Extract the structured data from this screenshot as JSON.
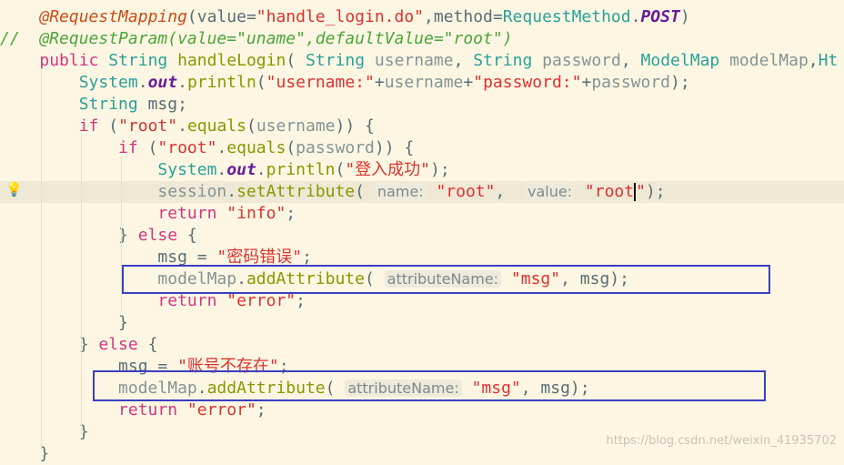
{
  "editor": {
    "highlighted_line": 8,
    "colors": {
      "background": "#fdf6e3",
      "keyword": "#d33682",
      "type": "#2aa198",
      "method": "#859900",
      "string": "#dc322f",
      "annotation_box": "#3a3fc4"
    },
    "lines": [
      [
        [
          "plain",
          "    "
        ],
        [
          "ann",
          "@RequestMapping"
        ],
        [
          "plain",
          "(value="
        ],
        [
          "str",
          "\"handle_login.do\""
        ],
        [
          "plain",
          ",method="
        ],
        [
          "type",
          "RequestMethod"
        ],
        [
          "plain",
          "."
        ],
        [
          "const",
          "POST"
        ],
        [
          "plain",
          ")"
        ]
      ],
      [
        [
          "comment",
          "//  @RequestParam(value=\"uname\",defaultValue=\"root\")"
        ]
      ],
      [
        [
          "plain",
          "    "
        ],
        [
          "kw",
          "public"
        ],
        [
          "plain",
          " "
        ],
        [
          "type",
          "String"
        ],
        [
          "plain",
          " "
        ],
        [
          "method",
          "handleLogin"
        ],
        [
          "plain",
          "( "
        ],
        [
          "type",
          "String"
        ],
        [
          "plain",
          " "
        ],
        [
          "param",
          "username"
        ],
        [
          "plain",
          ", "
        ],
        [
          "type",
          "String"
        ],
        [
          "plain",
          " "
        ],
        [
          "param",
          "password"
        ],
        [
          "plain",
          ", "
        ],
        [
          "type",
          "ModelMap"
        ],
        [
          "plain",
          " "
        ],
        [
          "param",
          "modelMap"
        ],
        [
          "plain",
          ","
        ],
        [
          "type",
          "Ht"
        ]
      ],
      [
        [
          "plain",
          "        "
        ],
        [
          "type",
          "System"
        ],
        [
          "plain",
          "."
        ],
        [
          "static",
          "out"
        ],
        [
          "plain",
          "."
        ],
        [
          "method",
          "println"
        ],
        [
          "plain",
          "("
        ],
        [
          "str",
          "\"username:\""
        ],
        [
          "plain",
          "+"
        ],
        [
          "param",
          "username"
        ],
        [
          "plain",
          "+"
        ],
        [
          "str",
          "\"password:\""
        ],
        [
          "plain",
          "+"
        ],
        [
          "param",
          "password"
        ],
        [
          "plain",
          ");"
        ]
      ],
      [
        [
          "plain",
          "        "
        ],
        [
          "type",
          "String"
        ],
        [
          "plain",
          " msg;"
        ]
      ],
      [
        [
          "plain",
          "        "
        ],
        [
          "kw",
          "if"
        ],
        [
          "plain",
          " ("
        ],
        [
          "str",
          "\"root\""
        ],
        [
          "plain",
          "."
        ],
        [
          "method",
          "equals"
        ],
        [
          "plain",
          "("
        ],
        [
          "param",
          "username"
        ],
        [
          "plain",
          ")) {"
        ]
      ],
      [
        [
          "plain",
          "            "
        ],
        [
          "kw",
          "if"
        ],
        [
          "plain",
          " ("
        ],
        [
          "str",
          "\"root\""
        ],
        [
          "plain",
          "."
        ],
        [
          "method",
          "equals"
        ],
        [
          "plain",
          "("
        ],
        [
          "param",
          "password"
        ],
        [
          "plain",
          ")) {"
        ]
      ],
      [
        [
          "plain",
          "                "
        ],
        [
          "type",
          "System"
        ],
        [
          "plain",
          "."
        ],
        [
          "static",
          "out"
        ],
        [
          "plain",
          "."
        ],
        [
          "method",
          "println"
        ],
        [
          "plain",
          "("
        ],
        [
          "str",
          "\"登入成功\""
        ],
        [
          "plain",
          ");"
        ]
      ],
      [
        [
          "plain",
          "                "
        ],
        [
          "param",
          "session"
        ],
        [
          "plain",
          "."
        ],
        [
          "method",
          "setAttribute"
        ],
        [
          "plain",
          "( "
        ],
        [
          "hint",
          "name:"
        ],
        [
          "plain",
          " "
        ],
        [
          "str",
          "\"root\""
        ],
        [
          "plain",
          ",  "
        ],
        [
          "hint",
          "value:"
        ],
        [
          "plain",
          " "
        ],
        [
          "str",
          "\"root"
        ],
        [
          "cursor",
          ""
        ],
        [
          "str",
          "\""
        ],
        [
          "plain",
          ");"
        ]
      ],
      [
        [
          "plain",
          "                "
        ],
        [
          "kw",
          "return"
        ],
        [
          "plain",
          " "
        ],
        [
          "str",
          "\"info\""
        ],
        [
          "plain",
          ";"
        ]
      ],
      [
        [
          "plain",
          "            } "
        ],
        [
          "kw",
          "else"
        ],
        [
          "plain",
          " {"
        ]
      ],
      [
        [
          "plain",
          "                msg = "
        ],
        [
          "str",
          "\"密码错误\""
        ],
        [
          "plain",
          ";"
        ]
      ],
      [
        [
          "plain",
          "                "
        ],
        [
          "param",
          "modelMap"
        ],
        [
          "plain",
          "."
        ],
        [
          "method",
          "addAttribute"
        ],
        [
          "plain",
          "( "
        ],
        [
          "hint",
          "attributeName:"
        ],
        [
          "plain",
          " "
        ],
        [
          "str",
          "\"msg\""
        ],
        [
          "plain",
          ", msg);"
        ]
      ],
      [
        [
          "plain",
          "                "
        ],
        [
          "kw",
          "return"
        ],
        [
          "plain",
          " "
        ],
        [
          "str",
          "\"error\""
        ],
        [
          "plain",
          ";"
        ]
      ],
      [
        [
          "plain",
          "            }"
        ]
      ],
      [
        [
          "plain",
          "        } "
        ],
        [
          "kw",
          "else"
        ],
        [
          "plain",
          " {"
        ]
      ],
      [
        [
          "plain",
          "            msg = "
        ],
        [
          "str",
          "\"账号不存在\""
        ],
        [
          "plain",
          ";"
        ]
      ],
      [
        [
          "plain",
          "            "
        ],
        [
          "param",
          "modelMap"
        ],
        [
          "plain",
          "."
        ],
        [
          "method",
          "addAttribute"
        ],
        [
          "plain",
          "( "
        ],
        [
          "hint",
          "attributeName:"
        ],
        [
          "plain",
          " "
        ],
        [
          "str",
          "\"msg\""
        ],
        [
          "plain",
          ", msg);"
        ]
      ],
      [
        [
          "plain",
          "            "
        ],
        [
          "kw",
          "return"
        ],
        [
          "plain",
          " "
        ],
        [
          "str",
          "\"error\""
        ],
        [
          "plain",
          ";"
        ]
      ],
      [
        [
          "plain",
          "        }"
        ]
      ],
      [
        [
          "plain",
          "    }"
        ]
      ]
    ]
  },
  "watermark": "https://blog.csdn.net/weixin_41935702"
}
